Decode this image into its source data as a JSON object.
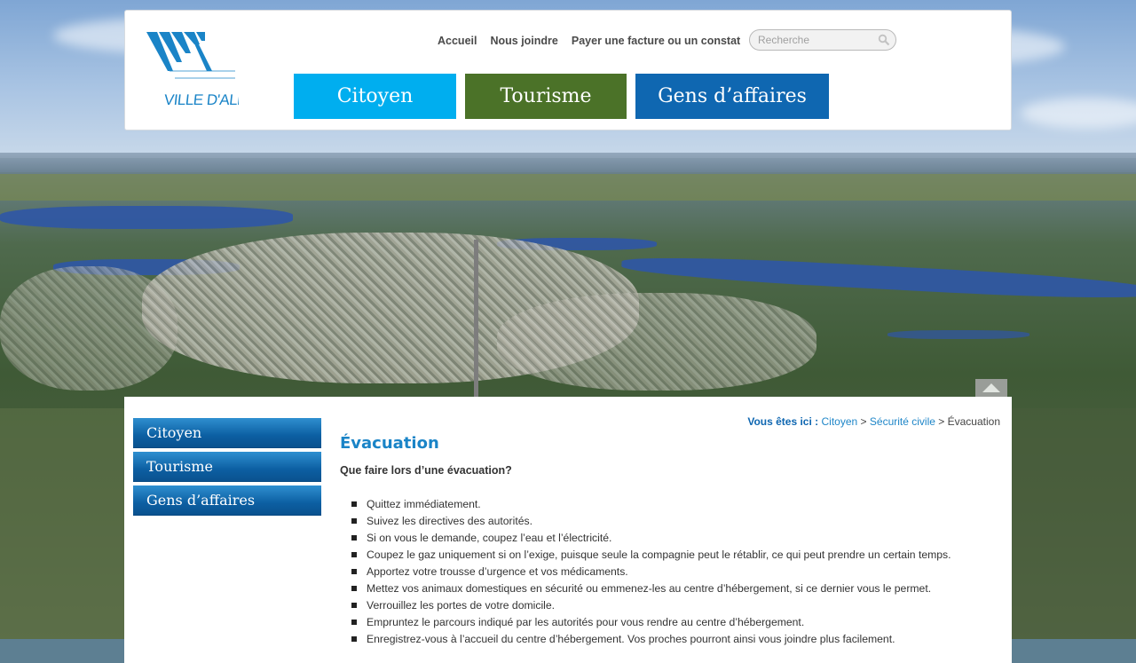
{
  "header": {
    "logo_text": "VILLE D'ALMA",
    "util_nav": [
      "Accueil",
      "Nous joindre",
      "Payer une facture ou un constat"
    ],
    "search_placeholder": "Recherche",
    "main_nav": [
      "Citoyen",
      "Tourisme",
      "Gens d’affaires"
    ]
  },
  "sidebar": {
    "items": [
      "Citoyen",
      "Tourisme",
      "Gens d’affaires"
    ]
  },
  "breadcrumb": {
    "lead": "Vous êtes ici :",
    "items": [
      "Citoyen",
      "Sécurité civile",
      "Évacuation"
    ],
    "separator": ">"
  },
  "main": {
    "title": "Évacuation",
    "intro": "Que faire lors d’une évacuation?",
    "steps": [
      "Quittez immédiatement.",
      "Suivez les directives des autorités.",
      "Si on vous le demande, coupez l’eau et l’électricité.",
      "Coupez le gaz uniquement si on l’exige, puisque seule la compagnie peut le rétablir, ce qui peut prendre un certain temps.",
      "Apportez votre trousse d’urgence et vos médicaments.",
      "Mettez vos animaux domestiques en sécurité ou emmenez-les au centre d’hébergement, si ce dernier vous le permet.",
      "Verrouillez les portes de votre domicile.",
      "Empruntez le parcours indiqué par les autorités pour vous rendre au centre d’hébergement.",
      "Enregistrez-vous à l’accueil du centre d’hébergement. Vos proches pourront ainsi vous joindre plus facilement."
    ]
  },
  "colors": {
    "citoyen": "#00aeef",
    "tourisme": "#4b7228",
    "affaires": "#0f67b1",
    "title": "#1a84c7",
    "logo": "#1a84c7"
  },
  "icons": {
    "search": "search-icon",
    "back_to_top": "triangle-up-icon"
  }
}
